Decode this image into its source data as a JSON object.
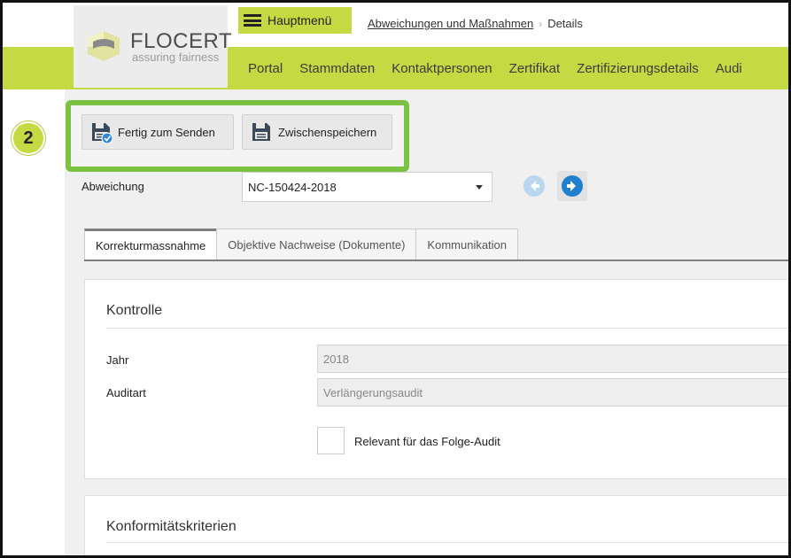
{
  "brand": {
    "name": "FLOCERT",
    "tagline": "assuring fairness",
    "accent_color": "#c5d943",
    "highlight_color": "#7cc242"
  },
  "header": {
    "menu_label": "Hauptmenü",
    "menu_icon": "hamburger-icon",
    "breadcrumb": {
      "link": "Abweichungen und Maßnahmen",
      "separator": "›",
      "current": "Details"
    }
  },
  "nav": {
    "items": [
      "Portal",
      "Stammdaten",
      "Kontaktpersonen",
      "Zertifikat",
      "Zertifizierungsdetails",
      "Audi"
    ]
  },
  "annotation": {
    "step_number": "2"
  },
  "toolbar": {
    "send_label": "Fertig zum Senden",
    "send_icon": "save-check-icon",
    "save_label": "Zwischenspeichern",
    "save_icon": "save-icon"
  },
  "deviation": {
    "label": "Abweichung",
    "selected": "NC-150424-2018",
    "prev_icon": "arrow-left-circle-icon",
    "next_icon": "arrow-right-circle-icon"
  },
  "tabs": [
    {
      "label": "Korrekturmassnahme",
      "active": true
    },
    {
      "label": "Objektive Nachweise (Dokumente)",
      "active": false
    },
    {
      "label": "Kommunikation",
      "active": false
    }
  ],
  "kontrolle": {
    "title": "Kontrolle",
    "fields": [
      {
        "label": "Jahr",
        "value": "2018"
      },
      {
        "label": "Auditart",
        "value": "Verlängerungsaudit"
      }
    ],
    "checkbox_label": "Relevant für das Folge-Audit",
    "checkbox_checked": false
  },
  "konformitaet": {
    "title": "Konformitätskriterien"
  }
}
